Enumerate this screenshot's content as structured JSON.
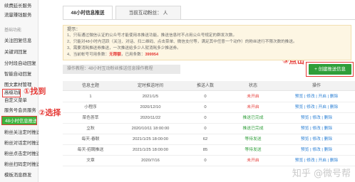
{
  "sidebar": {
    "items": [
      {
        "label": "续费延长服务"
      },
      {
        "label": "流量赚钱服务"
      },
      {
        "label": "基础功能"
      },
      {
        "label": "关注回复信息"
      },
      {
        "label": "关键词回复"
      },
      {
        "label": "分时段自动回复"
      },
      {
        "label": "智能自动回复"
      },
      {
        "label": "图文素材管理"
      },
      {
        "label": "自定义菜单"
      },
      {
        "label": "高级功能"
      },
      {
        "label": "服务号会员服务"
      },
      {
        "label": "48小时信息推送"
      },
      {
        "label": "粉丝关注定时推送"
      },
      {
        "label": "粉丝对话定时推送"
      },
      {
        "label": "粉丝点击定时推送"
      },
      {
        "label": "粉丝扫码定时推送"
      },
      {
        "label": "模板消息群发"
      }
    ]
  },
  "annotations": {
    "find": "①找到",
    "select": "②选择",
    "click": "③点击"
  },
  "tabs": [
    {
      "label": "48小时信息推送"
    },
    {
      "label": "当前互动粉丝：      人"
    }
  ],
  "tip": {
    "title": "提示：",
    "line1": "1、只有通过微信认证的公众号才能使用本推送功能，推送信息时不占用公众号规定的群发次数。",
    "line2": "2、只能对48小时内活跃（关注、对话、扫二维码、点击菜单、微信支付等，满足其中任意一个动作）的粉丝进行不限次数的推送。",
    "line3": "3、需要消耗推送券推送，一次推送给多少人就消耗多少推送券。",
    "line4_prefix": "4、当前帐号可用条数：",
    "line4_unlimited": "无限额",
    "line4_used_prefix": "，已用条数：",
    "line4_used": "399954"
  },
  "guide": "操作教程：48小时互动粉丝推送信息操作教程",
  "create_button": "+ 创建推送信息",
  "table": {
    "headers": [
      "信息主题",
      "定时推送时间",
      "推送人数",
      "状态",
      "操作"
    ],
    "rows": [
      {
        "topic": "1",
        "time": "2021/1/5",
        "count": "0",
        "status": "未开启",
        "status_type": "red",
        "ops": "预览 | 修改 | 开启 | 删除"
      },
      {
        "topic": "小程序",
        "time": "2020/12/10",
        "count": "0",
        "status": "未开启",
        "status_type": "red",
        "ops": "预览 | 修改 | 开启 | 删除"
      },
      {
        "topic": "菜色荟萃",
        "time": "2020/11/22",
        "count": "0",
        "status": "推送已完成",
        "status_type": "green",
        "ops": "预览 | 修改 | 删除"
      },
      {
        "topic": "立秋",
        "time": "2020/10/11 18:00:00",
        "count": "0",
        "status": "推送已完成",
        "status_type": "green",
        "ops": "预览 | 修改 | 删除"
      },
      {
        "topic": "每天-春联",
        "time": "2021/1/25 18:00:00",
        "count": "62",
        "status": "等待发送",
        "status_type": "green",
        "ops": "预览 | 修改 | 删除"
      },
      {
        "topic": "每天-招聘推送",
        "time": "2021/1/25 18:00:00",
        "count": "85",
        "status": "等待发送",
        "status_type": "green",
        "ops": "预览 | 修改 | 删除"
      },
      {
        "topic": "文章",
        "time": "2020/7/16",
        "count": "0",
        "status": "未开启",
        "status_type": "red",
        "ops": "预览 | 修改 | 开启 | 删除"
      }
    ]
  },
  "watermark": "知乎 @微号帮",
  "colors": {
    "accent_green": "#2f9e3a",
    "annotation_red": "#e53935",
    "link_blue": "#2a7fd4",
    "tip_bg": "#fdf6e3"
  }
}
